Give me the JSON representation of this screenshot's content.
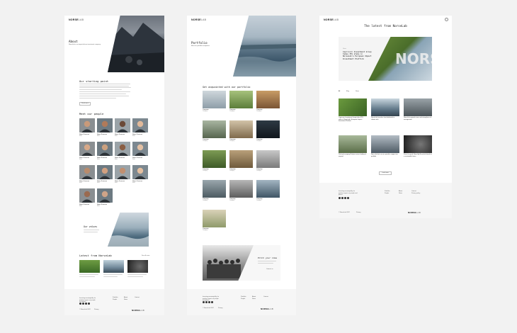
{
  "brand": {
    "name": "NORSE",
    "suffix": "LAB"
  },
  "about_page": {
    "hero_title": "About",
    "hero_text": "NorseLab is an impact-driven investment company.",
    "starting_title": "Our starting point",
    "starting_cta": "Read more",
    "people_title": "Meet our people",
    "people": [
      {
        "name": "Name Surname",
        "role": "Role"
      },
      {
        "name": "Name Surname",
        "role": "Role"
      },
      {
        "name": "Name Surname",
        "role": "Role"
      },
      {
        "name": "Name Surname",
        "role": "Role"
      },
      {
        "name": "Name Surname",
        "role": "Role"
      },
      {
        "name": "Name Surname",
        "role": "Role"
      },
      {
        "name": "Name Surname",
        "role": "Role"
      },
      {
        "name": "Name Surname",
        "role": "Role"
      },
      {
        "name": "Name Surname",
        "role": "Role"
      },
      {
        "name": "Name Surname",
        "role": "Role"
      },
      {
        "name": "Name Surname",
        "role": "Role"
      },
      {
        "name": "Name Surname",
        "role": "Role"
      },
      {
        "name": "Name Surname",
        "role": "Role"
      },
      {
        "name": "Name Surname",
        "role": "Role"
      }
    ],
    "values_title": "Our values",
    "latest_title": "Latest from NorseLab",
    "latest_link": "See all news"
  },
  "portfolio_page": {
    "hero_title": "Portfolio",
    "hero_text": "Meet our portfolio companies.",
    "list_title": "Get acquainted with our portfolio",
    "companies": [
      {
        "name": "Company",
        "tag": "Category"
      },
      {
        "name": "Company",
        "tag": "Category"
      },
      {
        "name": "Company",
        "tag": "Category"
      },
      {
        "name": "Company",
        "tag": "Category"
      },
      {
        "name": "Company",
        "tag": "Category"
      },
      {
        "name": "Company",
        "tag": "Category"
      },
      {
        "name": "Company",
        "tag": "Category"
      },
      {
        "name": "Company",
        "tag": "Category"
      },
      {
        "name": "Company",
        "tag": "Category"
      },
      {
        "name": "Company",
        "tag": "Category"
      },
      {
        "name": "Company",
        "tag": "Category"
      },
      {
        "name": "Company",
        "tag": "Category"
      },
      {
        "name": "Company",
        "tag": "Category"
      }
    ],
    "pitch_title": "Pitch your idea",
    "pitch_cta": "Contact us"
  },
  "news_page": {
    "title": "The latest from NorseLab",
    "featured_tag": "News",
    "featured_headline": "Capricorn Investment Group takes 35% stake in NorseLab's European Impact Investment Platform",
    "filters": [
      "All",
      "Blog",
      "News"
    ],
    "articles": [
      {
        "title": "Capricorn Investment Group takes 35% stake in NorseLab's European Impact Investment Platform"
      },
      {
        "title": "NorseLab launches fund dedicated to climate tech"
      },
      {
        "title": "NorseLab expands team and strengthens its management"
      },
      {
        "title": "Pet-food company Nutrient raises funding to expand"
      },
      {
        "title": "Sky's the limit: we are proud to support our portfolio"
      },
      {
        "title": "Force for good: Board by NorseLab heads to a sustainable future"
      }
    ],
    "load_more": "Load more"
  },
  "footer": {
    "tagline": "Investing meaningfully, for positive impact on people and planet",
    "cols": [
      [
        "Portfolio",
        "People"
      ],
      [
        "About",
        "News"
      ],
      [
        "Contact",
        "Privacy policy"
      ]
    ],
    "copyright": "© NorseLab 2022",
    "policy": "Privacy"
  },
  "colors": {
    "background": "#f2f2f2",
    "page": "#ffffff",
    "footer": "#f6f6f6",
    "accent_green": "#5c8f3a"
  }
}
